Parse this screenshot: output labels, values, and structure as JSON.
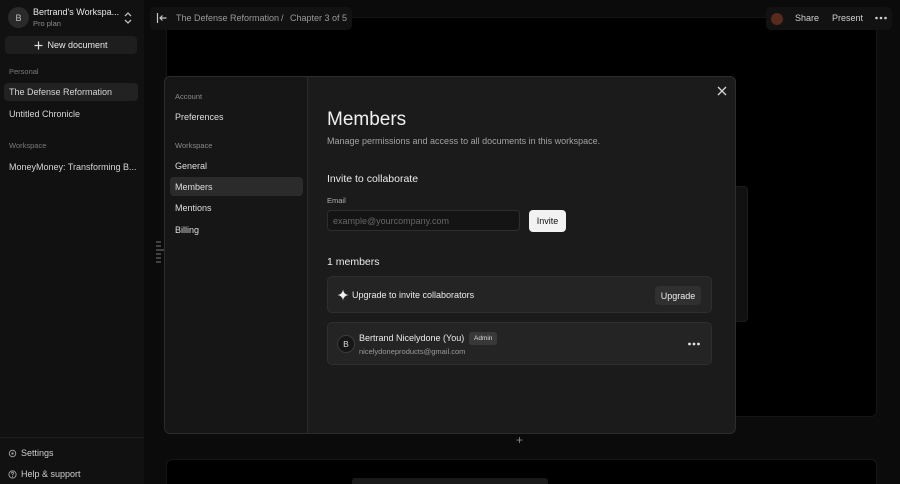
{
  "sidebar": {
    "workspace_avatar": "B",
    "workspace_name": "Bertrand's Workspa...",
    "workspace_plan": "Pro plan",
    "new_document": "New document",
    "section_personal": "Personal",
    "personal_items": [
      "The Defense Reformation",
      "Untitled Chronicle"
    ],
    "section_workspace": "Workspace",
    "workspace_items": [
      "MoneyMoney: Transforming B..."
    ],
    "settings": "Settings",
    "help": "Help & support"
  },
  "topbar": {
    "breadcrumb_doc": "The Defense Reformation",
    "breadcrumb_sep": "/",
    "breadcrumb_chapter": "Chapter 3 of 5",
    "share": "Share",
    "present": "Present"
  },
  "modal": {
    "nav_section_account": "Account",
    "nav_preferences": "Preferences",
    "nav_section_workspace": "Workspace",
    "nav_general": "General",
    "nav_members": "Members",
    "nav_mentions": "Mentions",
    "nav_billing": "Billing",
    "title": "Members",
    "subtitle": "Manage permissions and access to all documents in this workspace.",
    "invite_heading": "Invite to collaborate",
    "email_label": "Email",
    "email_placeholder": "example@yourcompany.com",
    "invite_button": "Invite",
    "members_count": "1 members",
    "upgrade_text": "Upgrade to invite collaborators",
    "upgrade_button": "Upgrade",
    "member": {
      "avatar": "B",
      "name": "Bertrand Nicelydone (You)",
      "role": "Admin",
      "email": "nicelydoneproducts@gmail.com"
    }
  },
  "icons": {
    "close": "close-icon",
    "sparkle": "sparkle-icon",
    "more": "more-horizontal-icon",
    "plus": "plus-icon",
    "settings": "gear-icon",
    "help": "help-icon",
    "collapse": "collapse-sidebar-icon",
    "chevron": "chevron-updown-icon"
  },
  "colors": {
    "background": "#0b0b0b",
    "modal": "#1b1b1b",
    "accent_button": "#f2f2f2"
  }
}
